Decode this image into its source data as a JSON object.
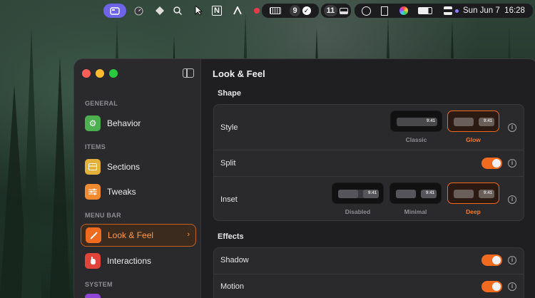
{
  "menubar": {
    "notch_badge": "9",
    "badge_eleven": "11",
    "clock": "Sun Jun 7  16:28",
    "n_glyph": "N"
  },
  "sidebar": {
    "sections": [
      "GENERAL",
      "ITEMS",
      "MENU BAR",
      "SYSTEM"
    ],
    "items": [
      {
        "label": "Behavior",
        "icon": "gear-icon",
        "color": "#4caf50"
      },
      {
        "label": "Sections",
        "icon": "sections-icon",
        "color": "#e3b13a"
      },
      {
        "label": "Tweaks",
        "icon": "sliders-icon",
        "color": "#f08a2e"
      },
      {
        "label": "Look & Feel",
        "icon": "brush-icon",
        "color": "#f06a1f"
      },
      {
        "label": "Interactions",
        "icon": "hand-icon",
        "color": "#e0443a"
      }
    ]
  },
  "content": {
    "title": "Look & Feel",
    "shape_title": "Shape",
    "effects_title": "Effects",
    "style_label": "Style",
    "split_label": "Split",
    "inset_label": "Inset",
    "shadow_label": "Shadow",
    "motion_label": "Motion",
    "style_options": [
      "Classic",
      "Glow"
    ],
    "inset_options": [
      "Disabled",
      "Minimal",
      "Deep"
    ],
    "preview_time": "9:41",
    "info_glyph": "i"
  },
  "colors": {
    "accent": "#f06a1f",
    "menubar_active": "#6e64e8"
  }
}
